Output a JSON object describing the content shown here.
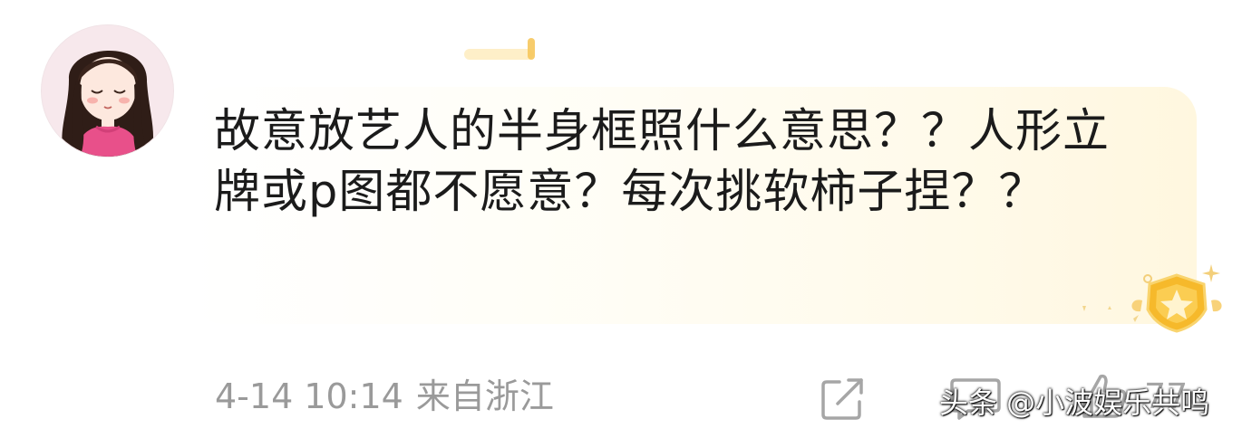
{
  "comment": {
    "text": "故意放艺人的半身框照什么意思？？人形立牌或p图都不愿意？每次挑软柿子捏？？",
    "date": "4-14 10:14",
    "location": "来自浙江",
    "like_count": "77"
  },
  "icons": {
    "avatar": "avatar-girl",
    "share": "share-icon",
    "comment": "comment-icon",
    "like": "thumbs-up-icon",
    "badge": "star-badge-icon"
  },
  "watermark": {
    "text": "头条 @小波娱乐共鸣"
  },
  "colors": {
    "text": "#1b1b1b",
    "meta": "#9a9a9a",
    "bubble": "#fff7df",
    "badge": "#f6b92b"
  }
}
